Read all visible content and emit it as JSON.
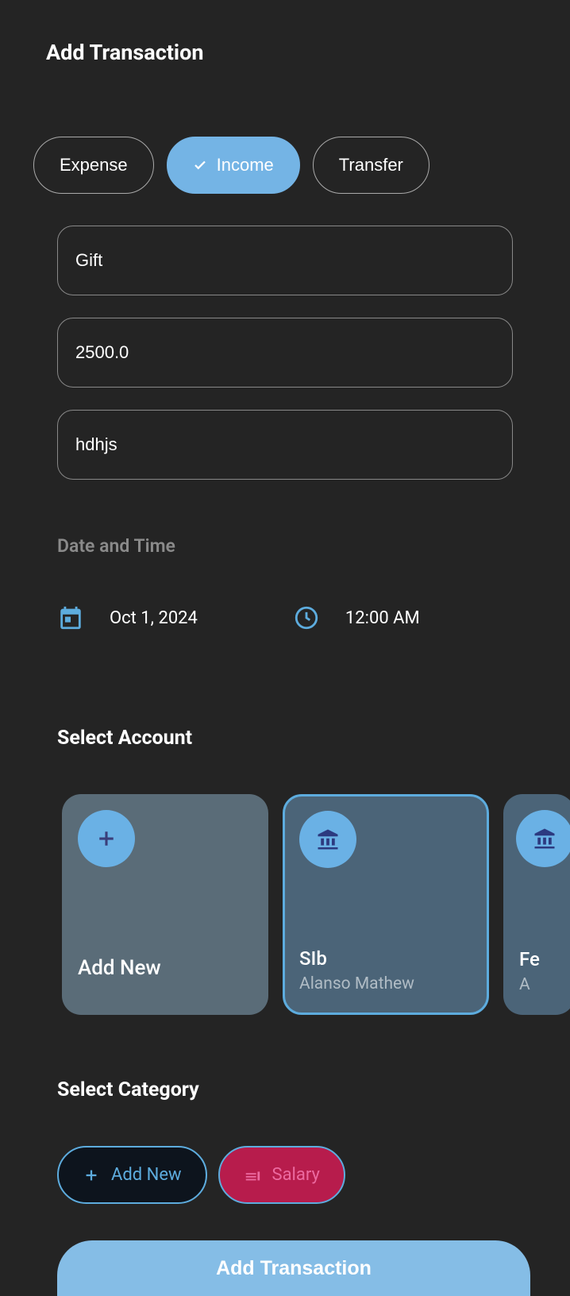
{
  "page": {
    "title": "Add Transaction"
  },
  "types": {
    "expense": "Expense",
    "income": "Income",
    "transfer": "Transfer"
  },
  "fields": {
    "title_value": "Gift",
    "amount_value": "2500.0",
    "note_value": "hdhjs"
  },
  "datetime": {
    "section_label": "Date and Time",
    "date": "Oct 1, 2024",
    "time": "12:00 AM"
  },
  "accounts": {
    "section_title": "Select Account",
    "add_new_label": "Add New",
    "items": [
      {
        "name": "SIb",
        "owner": "Alanso Mathew"
      },
      {
        "name": "Fe",
        "owner": "A"
      }
    ]
  },
  "categories": {
    "section_title": "Select Category",
    "add_new_label": "Add New",
    "selected": "Salary"
  },
  "submit": {
    "label": "Add Transaction"
  }
}
